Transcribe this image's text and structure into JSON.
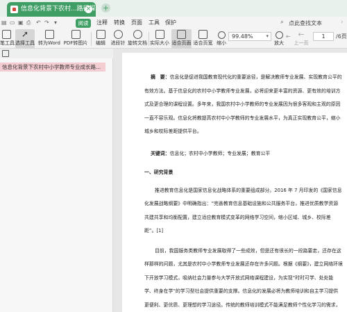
{
  "tabbar": {
    "doc_tab_title": "信息化背景下农村...路径探析.pdf",
    "close_glyph": "×",
    "new_tab_glyph": "+"
  },
  "menubar": {
    "items": [
      "阅读",
      "注释",
      "转换",
      "页面",
      "工具",
      "保护"
    ],
    "search_label": "点此查找文本"
  },
  "toolbar": {
    "buttons": [
      "笔工具",
      "选择工具",
      "转为Word",
      "PDF转图片",
      "编辑",
      "进段针",
      "旋转文档",
      "实际大小",
      "适合页面",
      "适合页宽",
      "缩小",
      "放大",
      "上一页"
    ],
    "zoom_value": "99.48%",
    "page_current": "1",
    "page_total": "/6页"
  },
  "sidebar": {
    "outline_item": "信息化背景下农村中小学教师专业成长路..."
  },
  "document": {
    "abstract_label": "摘　要：",
    "abstract": "信息化是促进我国教育现代化的重要途径，是解决教师专业发展、实现教育公平的有效方法。基于信息化的农村中小学教师专业发展，必将迎来更丰富的资源、更有效的培训方式及更合理的课程设置。多年来，我国农村中小学教师的专业发展因为很多客观和主观的原因一直不容乐观。信息化将教提高农村中小学教师的专业发展水平，为真正实现教育公平，缩小城乡和校际差距提供平台。",
    "keywords_label": "关键词：",
    "keywords": "信息化；农村中小学教师；专业发展；教育公平",
    "section1": "一、研究背景",
    "para1": "推进教育信息化是国家信息化战略体系的重要组成部分。2016 年 7 月印发的《国家信息化发展战略纲要》中明确指出：“完善教育信息基础设施和公共服务平台，推进优质教学资源共建共享和均衡配置，建立适应教育模式变革的网络学习空间，缩小区域、城乡、校际差距”。[1]",
    "para2": "目前，我国服务类教师专业发展取得了一些成效，但是还有很长的一段路要走，还存在这样那样的问题，尤其是农村中小学教师专业发展还存在许多问题。根据《纲要》，建立网络环境下开放学习模式，吸纳社会力量参与大学开放式网络课程建设，为实现“时时可学、处处能学、终身在学”的学习型社会提供重要的支撑。信息化的发展必将为教师培训和自主学习提供更便利、更优质、更理想的学习途径。传统的教师培训模式不能满足教师个性化学习的需求，难以解决工学矛盾。信息化将成"
  }
}
